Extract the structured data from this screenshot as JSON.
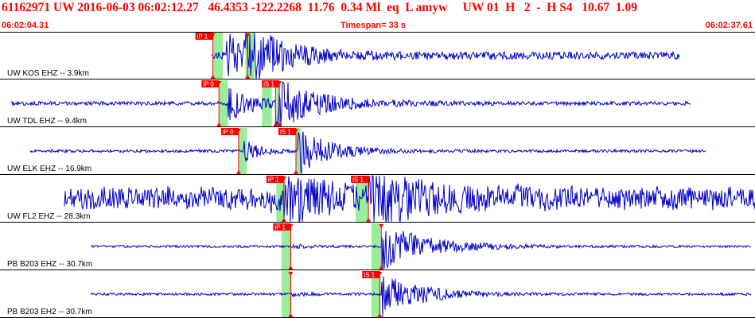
{
  "header": {
    "event_info": "61162971 UW 2016-06-03 06:02:12.27   46.4353 -122.2268  11.76  0.34 Ml  eq  L amyw     UW 01  H   2  -  H S4   10.67  1.09",
    "start_time": "06:02:04.31",
    "timespan_label": "Timespan=  33 s",
    "end_time": "06:02:37.61"
  },
  "colors": {
    "header_text": "#ff0000",
    "trace": "#0000cc",
    "pick_label_bg": "#ff0000",
    "pick_label_text": "#ffffff",
    "pick_window": "#99ee99",
    "pick_line": "#ff0000",
    "divider": "#000000"
  },
  "waveform_icon": "seismogram-trace",
  "traces": [
    {
      "label": "UW KOS EHZ -- 3.9km",
      "amplitude": 0.25,
      "noise_amp": 0.16,
      "drift_amp": 0.0,
      "signal_start": 0.28,
      "signal_end": 0.9,
      "seed": 7,
      "events": [
        {
          "time": 0.3,
          "amp": 0.9,
          "decay": 0.05
        },
        {
          "time": 0.325,
          "amp": 0.85,
          "decay": 0.05
        }
      ],
      "picks": [
        {
          "label": "iP 1",
          "time": 0.282,
          "window": [
            0.282,
            0.295
          ]
        },
        {
          "label": "",
          "time": 0.328,
          "window": [
            0.325,
            0.337
          ]
        }
      ]
    },
    {
      "label": "UW TDL EHZ -- 9.4km",
      "amplitude": 0.25,
      "noise_amp": 0.08,
      "drift_amp": 0.0,
      "signal_start": 0.015,
      "signal_end": 0.915,
      "seed": 11,
      "events": [
        {
          "time": 0.302,
          "amp": 0.8,
          "decay": 0.03
        },
        {
          "time": 0.365,
          "amp": 1.0,
          "decay": 0.06
        }
      ],
      "picks": [
        {
          "label": "iP 0",
          "time": 0.29,
          "window": [
            0.29,
            0.302
          ]
        },
        {
          "label": "",
          "time": 0.365,
          "window": [
            0.347,
            0.36
          ]
        },
        {
          "label": "iS 1",
          "time": 0.37,
          "window": [
            0.366,
            0.37
          ]
        }
      ]
    },
    {
      "label": "UW ELK EHZ -- 16.9km",
      "amplitude": 0.25,
      "noise_amp": 0.06,
      "drift_amp": 0.0,
      "signal_start": 0.04,
      "signal_end": 0.935,
      "seed": 23,
      "events": [
        {
          "time": 0.322,
          "amp": 0.5,
          "decay": 0.02
        },
        {
          "time": 0.395,
          "amp": 1.0,
          "decay": 0.04
        }
      ],
      "picks": [
        {
          "label": "iP 0",
          "time": 0.316,
          "window": [
            0.316,
            0.327
          ]
        },
        {
          "label": "iS 1",
          "time": 0.392,
          "window": [
            0.392,
            0.398
          ]
        }
      ]
    },
    {
      "label": "UW FL2 EHZ -- 28.3km",
      "amplitude": 0.25,
      "noise_amp": 0.45,
      "drift_amp": 0.3,
      "signal_start": 0.085,
      "signal_end": 1.0,
      "seed": 31,
      "events": [
        {
          "time": 0.376,
          "amp": 0.75,
          "decay": 0.06
        },
        {
          "time": 0.488,
          "amp": 1.0,
          "decay": 0.06
        }
      ],
      "picks": [
        {
          "label": "iP 1",
          "time": 0.376,
          "window": [
            0.366,
            0.378
          ]
        },
        {
          "label": "iS 1",
          "time": 0.488,
          "window": [
            0.471,
            0.488
          ]
        }
      ]
    },
    {
      "label": "PB B203 EHZ -- 30.7km",
      "amplitude": 0.25,
      "noise_amp": 0.05,
      "drift_amp": 0.0,
      "signal_start": 0.12,
      "signal_end": 0.995,
      "seed": 41,
      "events": [
        {
          "time": 0.385,
          "amp": 0.06,
          "decay": 0.03
        },
        {
          "time": 0.505,
          "amp": 1.0,
          "decay": 0.06
        }
      ],
      "picks": [
        {
          "label": "iP 1",
          "time": 0.385,
          "window": [
            0.373,
            0.386
          ]
        },
        {
          "label": "",
          "time": 0.505,
          "window": [
            0.492,
            0.504
          ]
        }
      ]
    },
    {
      "label": "PB B203 EH2 -- 30.7km",
      "amplitude": 0.25,
      "noise_amp": 0.05,
      "drift_amp": 0.0,
      "signal_start": 0.12,
      "signal_end": 0.995,
      "seed": 53,
      "events": [
        {
          "time": 0.385,
          "amp": 0.05,
          "decay": 0.03
        },
        {
          "time": 0.505,
          "amp": 1.0,
          "decay": 0.05
        }
      ],
      "picks": [
        {
          "label": "",
          "time": 0.385,
          "window": [
            0.373,
            0.386
          ]
        },
        {
          "label": "iS 1",
          "time": 0.503,
          "window": [
            0.492,
            0.504
          ]
        }
      ]
    }
  ]
}
